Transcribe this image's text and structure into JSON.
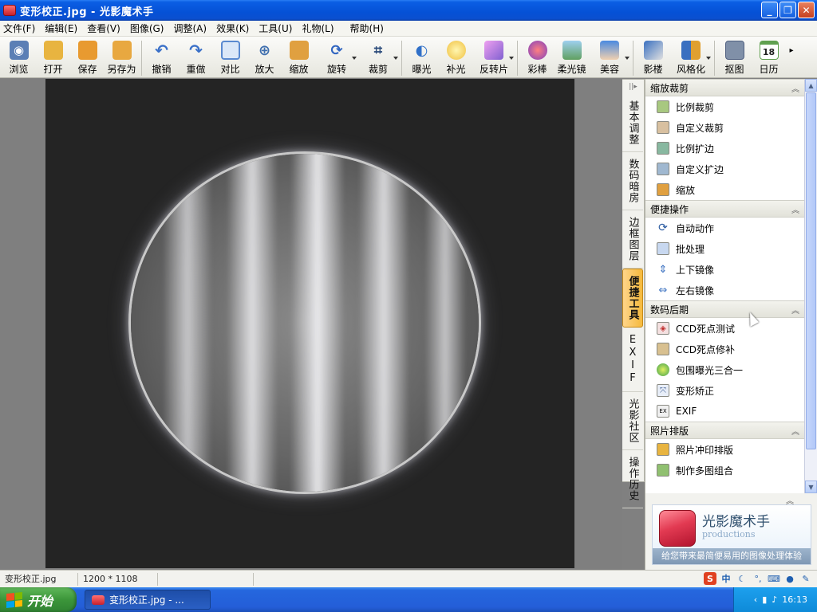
{
  "window": {
    "title": "变形校正.jpg - 光影魔术手",
    "min_label": "_",
    "max_label": "❐",
    "close_label": "✕"
  },
  "menu": [
    "文件(F)",
    "编辑(E)",
    "查看(V)",
    "图像(G)",
    "调整(A)",
    "效果(K)",
    "工具(U)",
    "礼物(L)",
    "帮助(H)"
  ],
  "toolbar": [
    {
      "label": "浏览",
      "icon": "browse-icon",
      "color": "#5b7fb5"
    },
    {
      "label": "打开",
      "icon": "open-folder-icon",
      "color": "#e8b440"
    },
    {
      "label": "保存",
      "icon": "save-icon",
      "color": "#e89a30"
    },
    {
      "label": "另存为",
      "icon": "save-as-icon",
      "color": "#e8a840"
    },
    {
      "label": "撤销",
      "icon": "undo-icon",
      "color": "#3a70c8"
    },
    {
      "label": "重做",
      "icon": "redo-icon",
      "color": "#3a70c8"
    },
    {
      "label": "对比",
      "icon": "compare-icon",
      "color": "#5a8ad0"
    },
    {
      "label": "放大",
      "icon": "zoom-in-icon",
      "color": "#3f6fae"
    },
    {
      "label": "缩放",
      "icon": "resize-icon",
      "color": "#e0a040"
    },
    {
      "label": "旋转",
      "icon": "rotate-icon",
      "color": "#2f64c0"
    },
    {
      "label": "裁剪",
      "icon": "crop-icon",
      "color": "#2a4a7a"
    },
    {
      "label": "曝光",
      "icon": "exposure-icon",
      "color": "#3070c8"
    },
    {
      "label": "补光",
      "icon": "fill-light-icon",
      "color": "#f0c040"
    },
    {
      "label": "反转片",
      "icon": "reversal-film-icon",
      "color": "#c86ad0"
    },
    {
      "label": "彩棒",
      "icon": "color-wand-icon",
      "color": "#d04060"
    },
    {
      "label": "柔光镜",
      "icon": "soft-focus-icon",
      "color": "#60a0d0"
    },
    {
      "label": "美容",
      "icon": "beauty-icon",
      "color": "#4a8ae0"
    },
    {
      "label": "影楼",
      "icon": "studio-icon",
      "color": "#3a70c0"
    },
    {
      "label": "风格化",
      "icon": "stylize-icon",
      "color": "#e0a030"
    },
    {
      "label": "抠图",
      "icon": "cutout-icon",
      "color": "#506080"
    },
    {
      "label": "日历",
      "icon": "calendar-icon",
      "color": "#60a050",
      "badge": "18"
    }
  ],
  "vtabs": [
    "基本调整",
    "数码暗房",
    "边框图层",
    "便捷工具",
    "EXIF",
    "光影社区",
    "操作历史"
  ],
  "panel": {
    "sections": [
      {
        "title": "缩放裁剪",
        "items": [
          {
            "label": "比例裁剪",
            "icon": "ratio-crop-icon"
          },
          {
            "label": "自定义裁剪",
            "icon": "custom-crop-icon"
          },
          {
            "label": "比例扩边",
            "icon": "ratio-expand-icon"
          },
          {
            "label": "自定义扩边",
            "icon": "custom-expand-icon"
          },
          {
            "label": "缩放",
            "icon": "resize-icon"
          }
        ]
      },
      {
        "title": "便捷操作",
        "items": [
          {
            "label": "自动动作",
            "icon": "auto-action-icon"
          },
          {
            "label": "批处理",
            "icon": "batch-process-icon"
          },
          {
            "label": "上下镜像",
            "icon": "flip-vertical-icon"
          },
          {
            "label": "左右镜像",
            "icon": "flip-horizontal-icon"
          }
        ]
      },
      {
        "title": "数码后期",
        "items": [
          {
            "label": "CCD死点测试",
            "icon": "ccd-test-icon"
          },
          {
            "label": "CCD死点修补",
            "icon": "ccd-repair-icon"
          },
          {
            "label": "包围曝光三合一",
            "icon": "hdr-merge-icon"
          },
          {
            "label": "变形矫正",
            "icon": "distortion-correct-icon"
          },
          {
            "label": "EXIF",
            "icon": "exif-icon"
          }
        ]
      },
      {
        "title": "照片排版",
        "items": [
          {
            "label": "照片冲印排版",
            "icon": "print-layout-icon"
          },
          {
            "label": "制作多图组合",
            "icon": "collage-icon"
          }
        ]
      }
    ]
  },
  "logo": {
    "name": "光影魔术手",
    "sub": "productions",
    "slogan": "给您带来最简便易用的图像处理体验"
  },
  "status": {
    "filename": "变形校正.jpg",
    "dimensions": "1200 * 1108"
  },
  "ime": {
    "s": "S",
    "lang": "中",
    "moon": "☾",
    "dots": "°,"
  },
  "taskbar": {
    "start": "开始",
    "task": "变形校正.jpg - ...",
    "clock": "16:13"
  },
  "colors": {
    "accent_orange": "#f5b93c",
    "xp_blue": "#245ed8",
    "start_green": "#3c963a"
  }
}
